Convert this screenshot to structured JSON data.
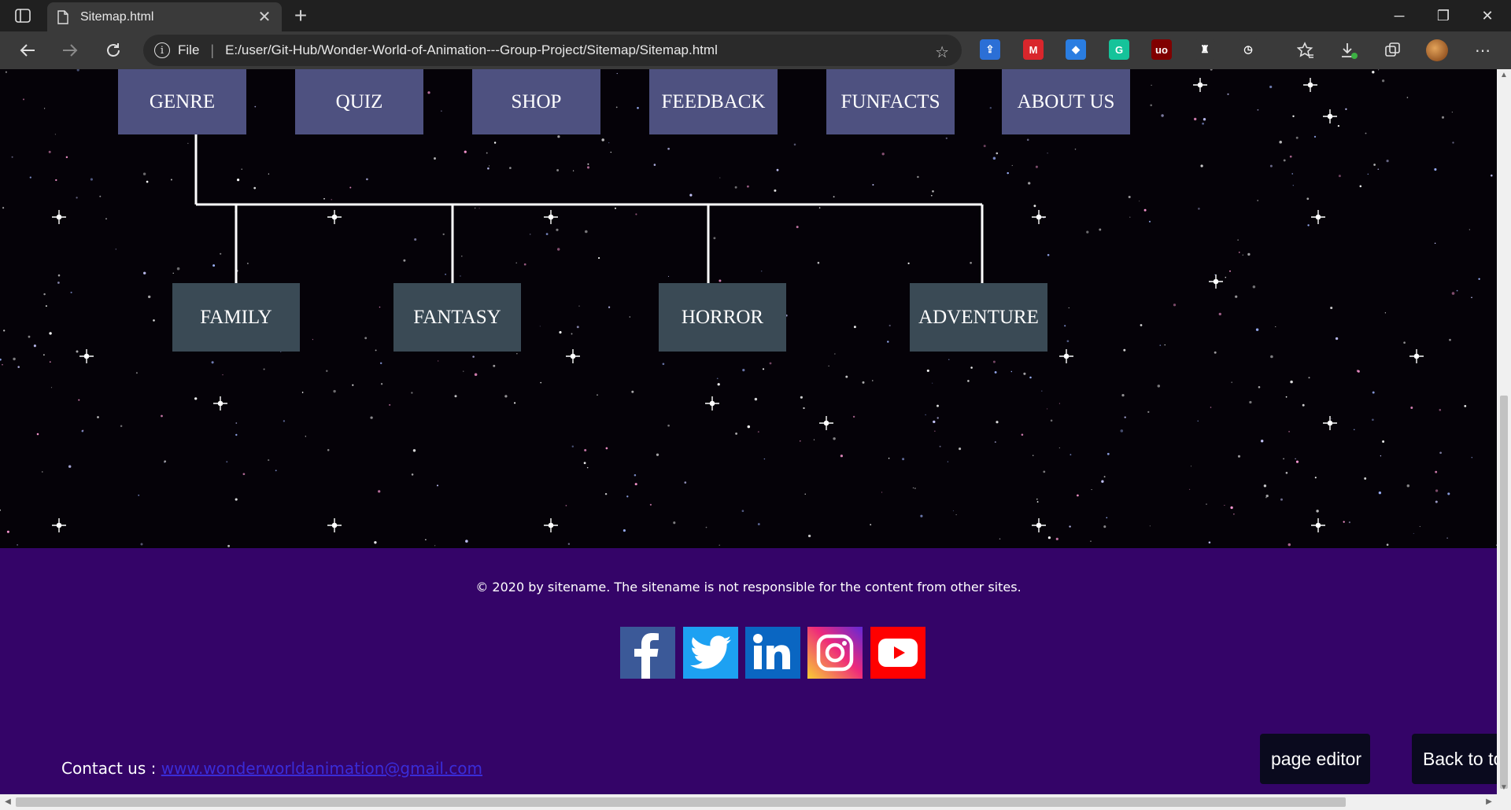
{
  "browser": {
    "tab_title": "Sitemap.html",
    "tab_close": "✕",
    "new_tab": "+",
    "file_label": "File",
    "url": "E:/user/Git-Hub/Wonder-World-of-Animation---Group-Project/Sitemap/Sitemap.html",
    "window_min": "─",
    "window_max": "❐",
    "window_close": "✕",
    "icons": [
      "tab-actions-icon",
      "back-icon",
      "forward-icon",
      "reload-icon",
      "info-icon",
      "add-favorite-icon",
      "favorites-icon",
      "downloads-icon",
      "collections-icon",
      "profile-icon",
      "more-icon"
    ],
    "extensions": [
      {
        "name": "bookmark-ext",
        "color": "#2b6fd6",
        "glyph": "⇪"
      },
      {
        "name": "mendeley-ext",
        "color": "#d9262c",
        "glyph": "M"
      },
      {
        "name": "blue-ext",
        "color": "#2a7de1",
        "glyph": "◆"
      },
      {
        "name": "grammarly-ext",
        "color": "#15c39a",
        "glyph": "G"
      },
      {
        "name": "ublock-ext",
        "color": "#800000",
        "glyph": "uo"
      },
      {
        "name": "github-ext",
        "color": "#3a3a3a",
        "glyph": "♜"
      },
      {
        "name": "clock-ext",
        "color": "#3a3a3a",
        "glyph": "◷"
      }
    ]
  },
  "nav": [
    {
      "label": "GENRE"
    },
    {
      "label": "QUIZ"
    },
    {
      "label": "SHOP"
    },
    {
      "label": "FEEDBACK"
    },
    {
      "label": "FUNFACTS"
    },
    {
      "label": "ABOUT US"
    }
  ],
  "genres": [
    {
      "label": "FAMILY"
    },
    {
      "label": "FANTASY"
    },
    {
      "label": "HORROR"
    },
    {
      "label": "ADVENTURE"
    }
  ],
  "footer": {
    "copyright": "© 2020 by sitename. The sitename is not responsible for the content from other sites.",
    "contact_label": "Contact us : ",
    "contact_link": "www.wonderworldanimation@gmail.com",
    "page_editor": "page editor",
    "back_to_top": "Back to top",
    "social": [
      {
        "name": "facebook-icon",
        "color": "#3b5998"
      },
      {
        "name": "twitter-icon",
        "color": "#1da1f2"
      },
      {
        "name": "linkedin-icon",
        "color": "#0a66c2"
      },
      {
        "name": "instagram-icon",
        "color": "#c13584"
      },
      {
        "name": "youtube-icon",
        "color": "#ff0000"
      }
    ]
  },
  "colors": {
    "footer_bg": "#340468",
    "nav_box": "#4e5180",
    "genre_box": "#3a4a55",
    "link": "#3a2cd8"
  }
}
